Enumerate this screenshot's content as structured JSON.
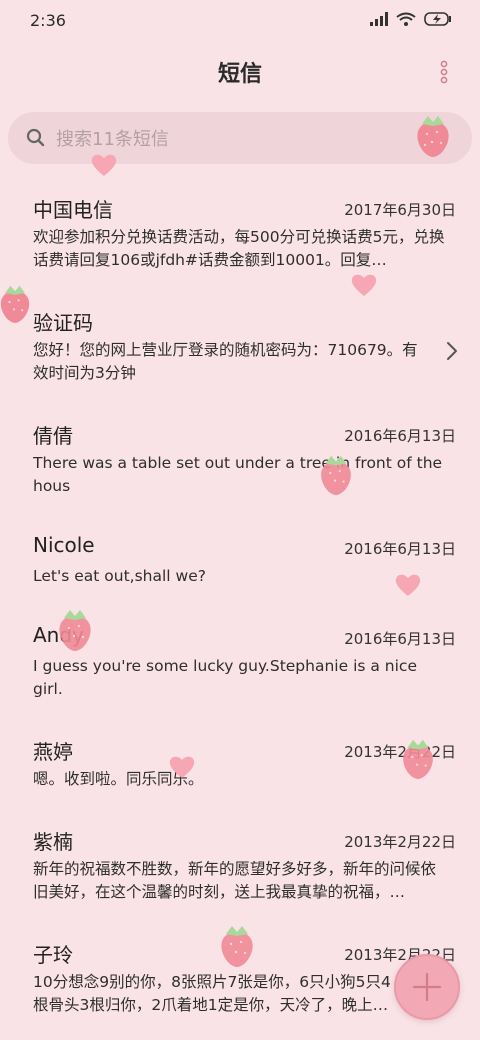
{
  "status_bar": {
    "time": "2:36"
  },
  "header": {
    "title": "短信"
  },
  "search": {
    "placeholder": "搜索11条短信"
  },
  "messages": [
    {
      "sender": "中国电信",
      "date": "2017年6月30日",
      "preview": "欢迎参加积分兑换话费活动，每500分可兑换话费5元，兑换话费请回复106或jfdh#话费金额到10001。回复…"
    },
    {
      "sender": "验证码",
      "date": "",
      "preview": "您好！您的网上营业厅登录的随机密码为：710679。有效时间为3分钟"
    },
    {
      "sender": "倩倩",
      "date": "2016年6月13日",
      "preview": "There was a table set out under a tree in front of the hous"
    },
    {
      "sender": "Nicole",
      "date": "2016年6月13日",
      "preview": "Let's eat out,shall we?"
    },
    {
      "sender": "Andy",
      "date": "2016年6月13日",
      "preview": "I guess you're some lucky guy.Stephanie is a nice girl."
    },
    {
      "sender": "燕婷",
      "date": "2013年2月22日",
      "preview": "嗯。收到啦。同乐同乐。"
    },
    {
      "sender": "紫楠",
      "date": "2013年2月22日",
      "preview": "新年的祝福数不胜数，新年的愿望好多好多，新年的问候依旧美好，在这个温馨的时刻，送上我最真挚的祝福，…"
    },
    {
      "sender": "子玲",
      "date": "2013年2月22日",
      "preview": "10分想念9别的你，8张照片7张是你，6只小狗5只4根骨头3根归你，2爪着地1定是你，天冷了，晚上…"
    }
  ],
  "colors": {
    "background": "#f9e3e6",
    "search_bg": "#efd5da",
    "fab": "#f3a9b5",
    "strawberry": "#ef8a96",
    "heart": "#f7a6b4"
  },
  "icons": {
    "search": "search-icon",
    "more": "more-vertical-icon",
    "chevron": "chevron-right-icon",
    "compose": "plus-icon"
  }
}
